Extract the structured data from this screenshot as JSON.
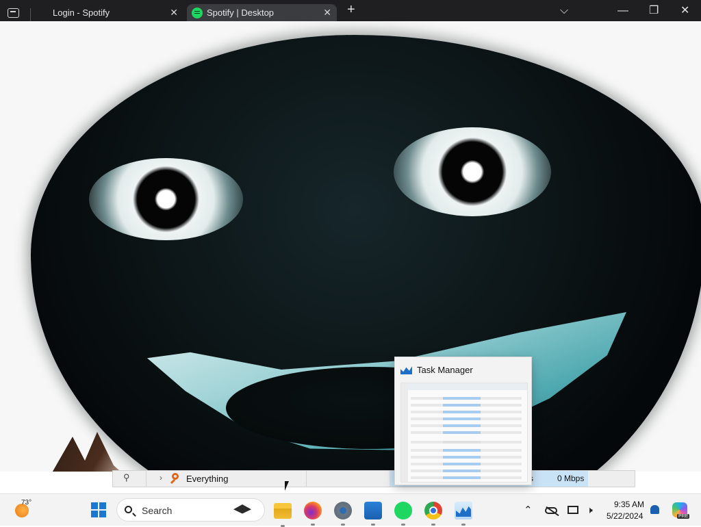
{
  "browser": {
    "tabs": [
      {
        "label": "Login - Spotify",
        "active": false
      },
      {
        "label": "Spotify | Desktop",
        "active": true
      }
    ],
    "close_glyph": "✕",
    "new_tab_glyph": "+",
    "tab_list_glyph": "⌵",
    "window_controls": {
      "minimize": "—",
      "maximize": "❐",
      "close": "✕"
    }
  },
  "thumbnail": {
    "title": "Task Manager",
    "icon": "task-manager-icon"
  },
  "background_window": {
    "pin_glyph": "⚲",
    "chevron": "›",
    "label": "Everything",
    "partial_text": "s",
    "network_speed": "0 Mbps"
  },
  "taskbar": {
    "weather_temp": "73°",
    "search_placeholder": "Search",
    "apps": [
      "file-explorer",
      "firefox",
      "settings",
      "microsoft-store",
      "spotify",
      "chrome",
      "task-manager"
    ],
    "clock": {
      "time": "9:35 AM",
      "date": "5/22/2024"
    },
    "tray_chevron": "⌃",
    "speaker_glyph": "🕨",
    "copilot_badge": "PRE"
  },
  "colors": {
    "tabbar_bg": "#1f1f21",
    "active_tab": "#3b3c40",
    "taskbar_bg": "#f3f3f3",
    "accent": "#1a78d2",
    "spotify_green": "#1ed760"
  }
}
